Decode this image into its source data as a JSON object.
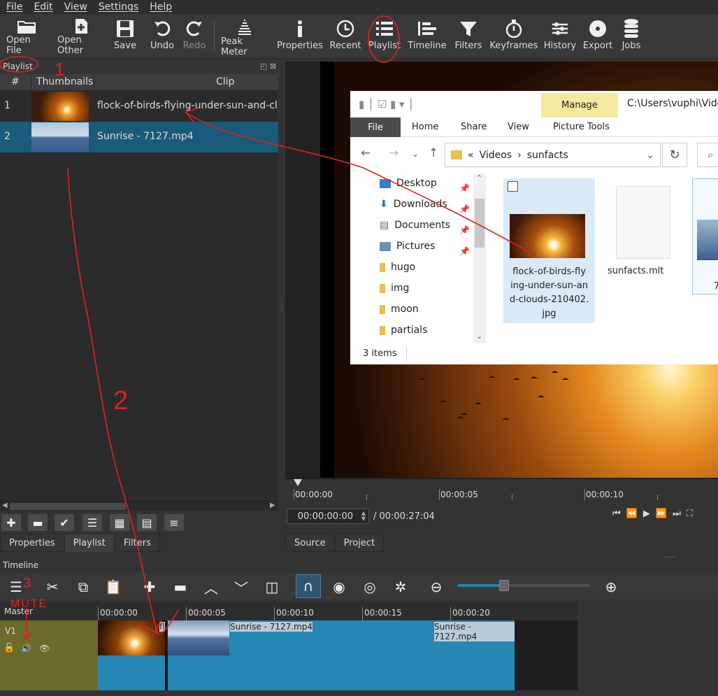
{
  "menu": [
    "File",
    "Edit",
    "View",
    "Settings",
    "Help"
  ],
  "toolbar": [
    {
      "label": "Open File",
      "icon": "folder-open-icon"
    },
    {
      "label": "Open Other",
      "icon": "open-other-icon"
    },
    {
      "label": "Save",
      "icon": "save-icon"
    },
    {
      "label": "Undo",
      "icon": "undo-icon"
    },
    {
      "label": "Redo",
      "icon": "redo-icon"
    },
    {
      "label": "Peak Meter",
      "icon": "peak-meter-icon"
    },
    {
      "label": "Properties",
      "icon": "info-icon"
    },
    {
      "label": "Recent",
      "icon": "clock-icon"
    },
    {
      "label": "Playlist",
      "icon": "list-icon"
    },
    {
      "label": "Timeline",
      "icon": "timeline-icon"
    },
    {
      "label": "Filters",
      "icon": "funnel-icon"
    },
    {
      "label": "Keyframes",
      "icon": "stopwatch-icon"
    },
    {
      "label": "History",
      "icon": "history-icon"
    },
    {
      "label": "Export",
      "icon": "disc-icon"
    },
    {
      "label": "Jobs",
      "icon": "database-icon"
    }
  ],
  "playlist": {
    "title": "Playlist",
    "columns": [
      "#",
      "Thumbnails",
      "Clip"
    ],
    "rows": [
      {
        "num": "1",
        "clip": "flock-of-birds-flying-under-sun-and-clo"
      },
      {
        "num": "2",
        "clip": "Sunrise - 7127.mp4"
      }
    ],
    "tabs": [
      "Properties",
      "Playlist",
      "Filters"
    ]
  },
  "player": {
    "ruler": [
      "00:00:00",
      "00:00:05",
      "00:00:10"
    ],
    "timecode": "00:00:00:00",
    "total": "/ 00:00:27:04",
    "tabs": [
      "Source",
      "Project"
    ]
  },
  "explorer": {
    "manage": "Manage",
    "path": "C:\\Users\\vuphi\\Vide",
    "ribbon": [
      "File",
      "Home",
      "Share",
      "View",
      "Picture Tools"
    ],
    "address": [
      "«",
      "Videos",
      "›",
      "sunfacts"
    ],
    "tree": [
      "Desktop",
      "Downloads",
      "Documents",
      "Pictures",
      "hugo",
      "img",
      "moon",
      "partials"
    ],
    "files": [
      "flock-of-birds-fly ing-under-sun-an d-clouds-210402. jpg",
      "sunfacts.mlt",
      "7"
    ],
    "status": "3 items"
  },
  "timeline": {
    "title": "Timeline",
    "master": "Master",
    "track": "V1",
    "ruler": [
      "00:00:00",
      "00:00:05",
      "00:00:10",
      "00:00:15",
      "00:00:20"
    ],
    "clip_labels": [
      "fl",
      "Sunrise - 7127.mp4",
      "Sunrise - 7127.mp4"
    ]
  },
  "annotations": {
    "one": "1",
    "two": "2",
    "three": "3",
    "mute": "MUTE"
  },
  "colors": {
    "selection": "#1a5a7a",
    "clip": "#2587b3",
    "track_header": "#6b6b2b",
    "annotation": "#e02020"
  }
}
